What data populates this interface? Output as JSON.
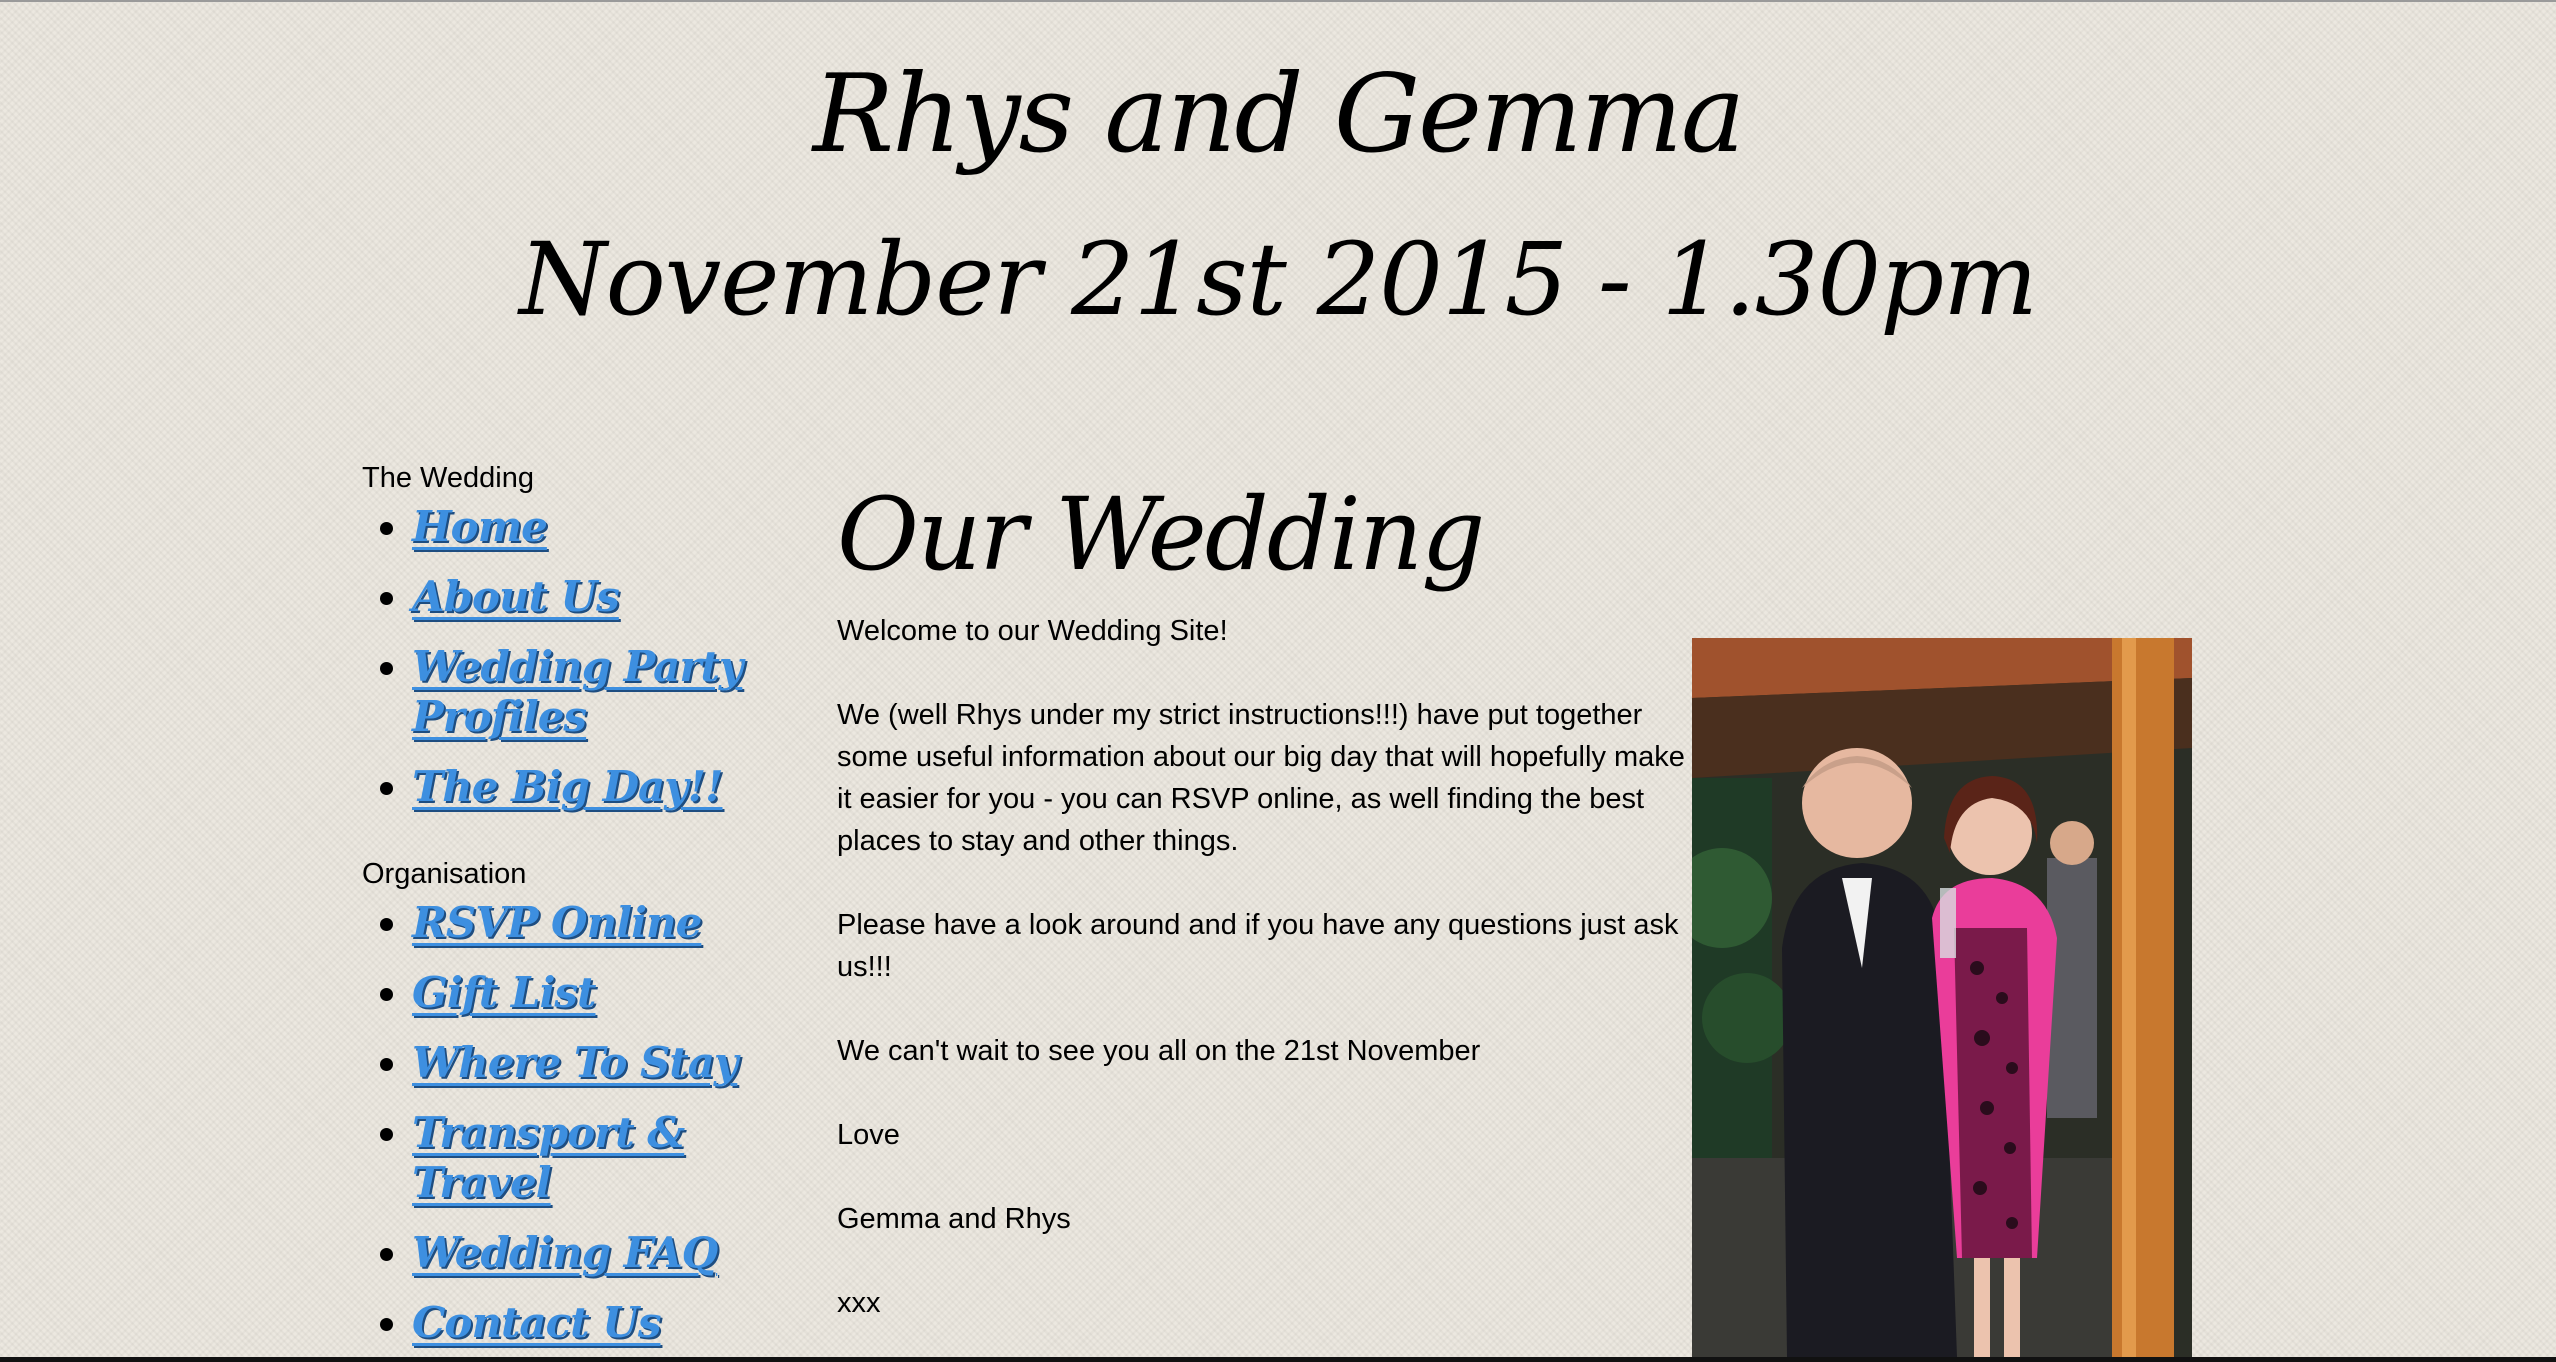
{
  "header": {
    "title": "Rhys and Gemma",
    "date": "November 21st 2015  - 1.30pm"
  },
  "sidebar": {
    "groups": [
      {
        "title": "The Wedding",
        "items": [
          {
            "label": "Home"
          },
          {
            "label": "About Us"
          },
          {
            "label": "Wedding Party Profiles"
          },
          {
            "label": "The Big Day!!"
          }
        ]
      },
      {
        "title": "Organisation",
        "items": [
          {
            "label": "RSVP Online"
          },
          {
            "label": "Gift List"
          },
          {
            "label": "Where To Stay"
          },
          {
            "label": "Transport & Travel"
          },
          {
            "label": "Wedding FAQ"
          },
          {
            "label": "Contact Us"
          }
        ]
      }
    ]
  },
  "main": {
    "heading": "Our Wedding",
    "paragraphs": [
      "Welcome to our Wedding Site!",
      "We (well Rhys under my strict instructions!!!) have put together some useful information about our big day that will hopefully make it easier for you - you can RSVP online, as well finding the best places to stay and other things.",
      "Please have a look around and if you have any questions just ask us!!!",
      "We can't wait to see you all on the 21st November",
      "Love",
      "Gemma and Rhys",
      "xxx"
    ]
  },
  "colors": {
    "link": "#3d8fe0",
    "link_shadow": "#1e4d80",
    "background": "#ece8e0"
  }
}
